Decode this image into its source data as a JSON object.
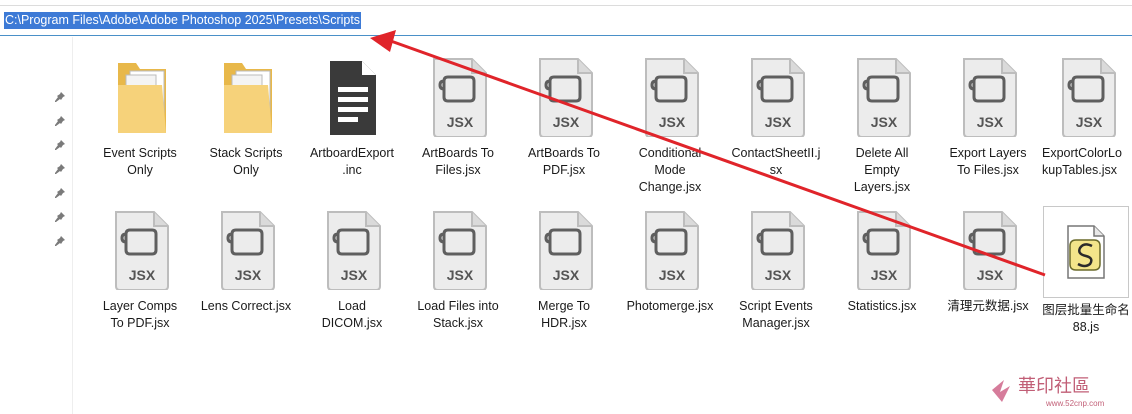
{
  "address": {
    "path": "C:\\Program Files\\Adobe\\Adobe Photoshop 2025\\Presets\\Scripts"
  },
  "colors": {
    "selection": "#3d7ad6",
    "arrow": "#e0242a",
    "icon_fill": "#ececec",
    "icon_stroke": "#6a6a6a",
    "folder": "#f6d27a"
  },
  "files": [
    {
      "name": "Event Scripts\nOnly",
      "kind": "folder"
    },
    {
      "name": "Stack Scripts\nOnly",
      "kind": "folder"
    },
    {
      "name": "ArtboardExport\n.inc",
      "kind": "document"
    },
    {
      "name": "ArtBoards To\nFiles.jsx",
      "kind": "jsx"
    },
    {
      "name": "ArtBoards To\nPDF.jsx",
      "kind": "jsx"
    },
    {
      "name": "Conditional\nMode\nChange.jsx",
      "kind": "jsx"
    },
    {
      "name": "ContactSheetII.j\nsx",
      "kind": "jsx"
    },
    {
      "name": "Delete All\nEmpty\nLayers.jsx",
      "kind": "jsx"
    },
    {
      "name": "Export Layers\nTo Files.jsx",
      "kind": "jsx"
    },
    {
      "name": "ExportColorLo\nkupTables.jsx",
      "kind": "jsx"
    },
    {
      "name": "Layer Comps\nTo PDF.jsx",
      "kind": "jsx"
    },
    {
      "name": "Lens Correct.jsx",
      "kind": "jsx"
    },
    {
      "name": "Load\nDICOM.jsx",
      "kind": "jsx"
    },
    {
      "name": "Load Files into\nStack.jsx",
      "kind": "jsx"
    },
    {
      "name": "Merge To\nHDR.jsx",
      "kind": "jsx"
    },
    {
      "name": "Photomerge.jsx",
      "kind": "jsx"
    },
    {
      "name": "Script Events\nManager.jsx",
      "kind": "jsx"
    },
    {
      "name": "Statistics.jsx",
      "kind": "jsx"
    },
    {
      "name": "清理元数据.jsx",
      "kind": "jsx"
    },
    {
      "name": "图层批量生命名\n88.js",
      "kind": "js"
    }
  ],
  "jsx_badge": "JSX",
  "watermark": {
    "text": "華印社區",
    "url": "www.52cnp.com"
  }
}
